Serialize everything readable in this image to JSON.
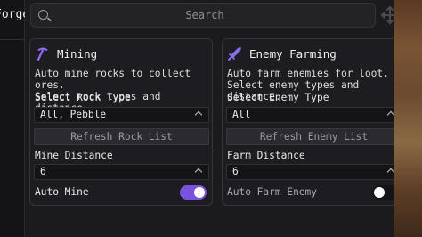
{
  "sidebar": {
    "tab_label": "Forge"
  },
  "search": {
    "placeholder": "Search"
  },
  "colors": {
    "accent": "#7b52e0",
    "panel_bg": "#1d1d21",
    "background": "#1b1b1e"
  },
  "mining": {
    "title": "Mining",
    "icon": "pickaxe-icon",
    "description": "Auto mine rocks to collect ores.\nSelect rock types and distance.",
    "select_label": "Select Rock Type",
    "select_value": "All, Pebble",
    "refresh_label": "Refresh Rock List",
    "distance_label": "Mine Distance",
    "distance_value": "6",
    "toggle_label": "Auto Mine",
    "toggle_on": true
  },
  "farming": {
    "title": "Enemy Farming",
    "icon": "sword-icon",
    "description": "Auto farm enemies for loot.\nSelect enemy types and distance.",
    "select_label": "Select Enemy Type",
    "select_value": "All",
    "refresh_label": "Refresh Enemy List",
    "distance_label": "Farm Distance",
    "distance_value": "6",
    "toggle_label": "Auto Farm Enemy",
    "toggle_on": false
  }
}
